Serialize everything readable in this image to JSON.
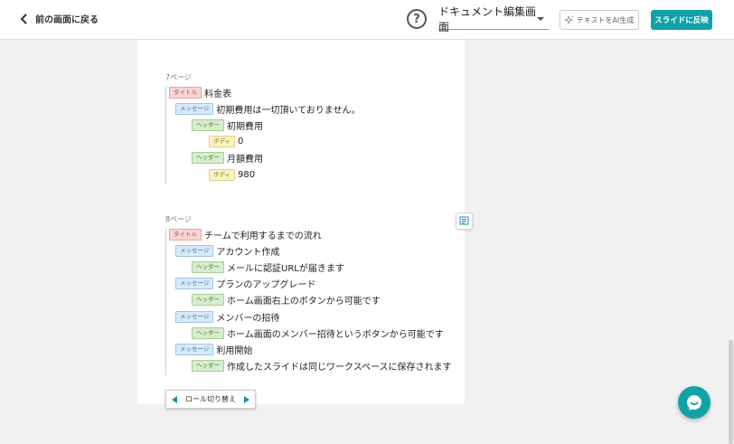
{
  "header": {
    "back_label": "前の画面に戻る",
    "help_glyph": "?",
    "doc_select_value": "ドキュメント編集画面",
    "ai_button_label": "テキストをAI生成",
    "apply_button_label": "スライドに反映"
  },
  "tags": {
    "title": "タイトル",
    "message": "メッセージ",
    "header": "ヘッダー",
    "body": "ボディ"
  },
  "pages": [
    {
      "label": "7ページ",
      "rows": [
        {
          "type": "title",
          "text": "料金表"
        },
        {
          "type": "message",
          "text": "初期費用は一切頂いておりません。"
        },
        {
          "type": "header",
          "text": "初期費用"
        },
        {
          "type": "body",
          "text": "0"
        },
        {
          "type": "header",
          "text": "月額費用"
        },
        {
          "type": "body",
          "text": "980"
        }
      ]
    },
    {
      "label": "8ページ",
      "rows": [
        {
          "type": "title",
          "text": "チームで利用するまでの流れ"
        },
        {
          "type": "message",
          "text": "アカウント作成"
        },
        {
          "type": "header",
          "text": "メールに認証URLが届きます"
        },
        {
          "type": "message",
          "text": "プランのアップグレード"
        },
        {
          "type": "header",
          "text": "ホーム画面右上のボタンから可能です"
        },
        {
          "type": "message",
          "text": "メンバーの招待"
        },
        {
          "type": "header",
          "text": "ホーム画面のメンバー招待というボタンから可能です"
        },
        {
          "type": "message",
          "text": "利用開始"
        },
        {
          "type": "header",
          "text": "作成したスライドは同じワークスペースに保存されます"
        }
      ]
    }
  ],
  "role_switch": {
    "label": "ロール切り替え"
  },
  "icons": {
    "back": "chevron-left-icon",
    "help": "help-circle-icon",
    "dropdown": "caret-down-icon",
    "ai": "sparkle-icon",
    "memo": "note-icon",
    "role_prev": "triangle-left-icon",
    "role_next": "triangle-right-icon",
    "chat": "chat-bubble-icon"
  },
  "colors": {
    "accent": "#10a2a6",
    "title_tag": "#f9d5d5",
    "message_tag": "#d8eaf8",
    "header_tag": "#d8eccf",
    "body_tag": "#fbf2c4"
  }
}
